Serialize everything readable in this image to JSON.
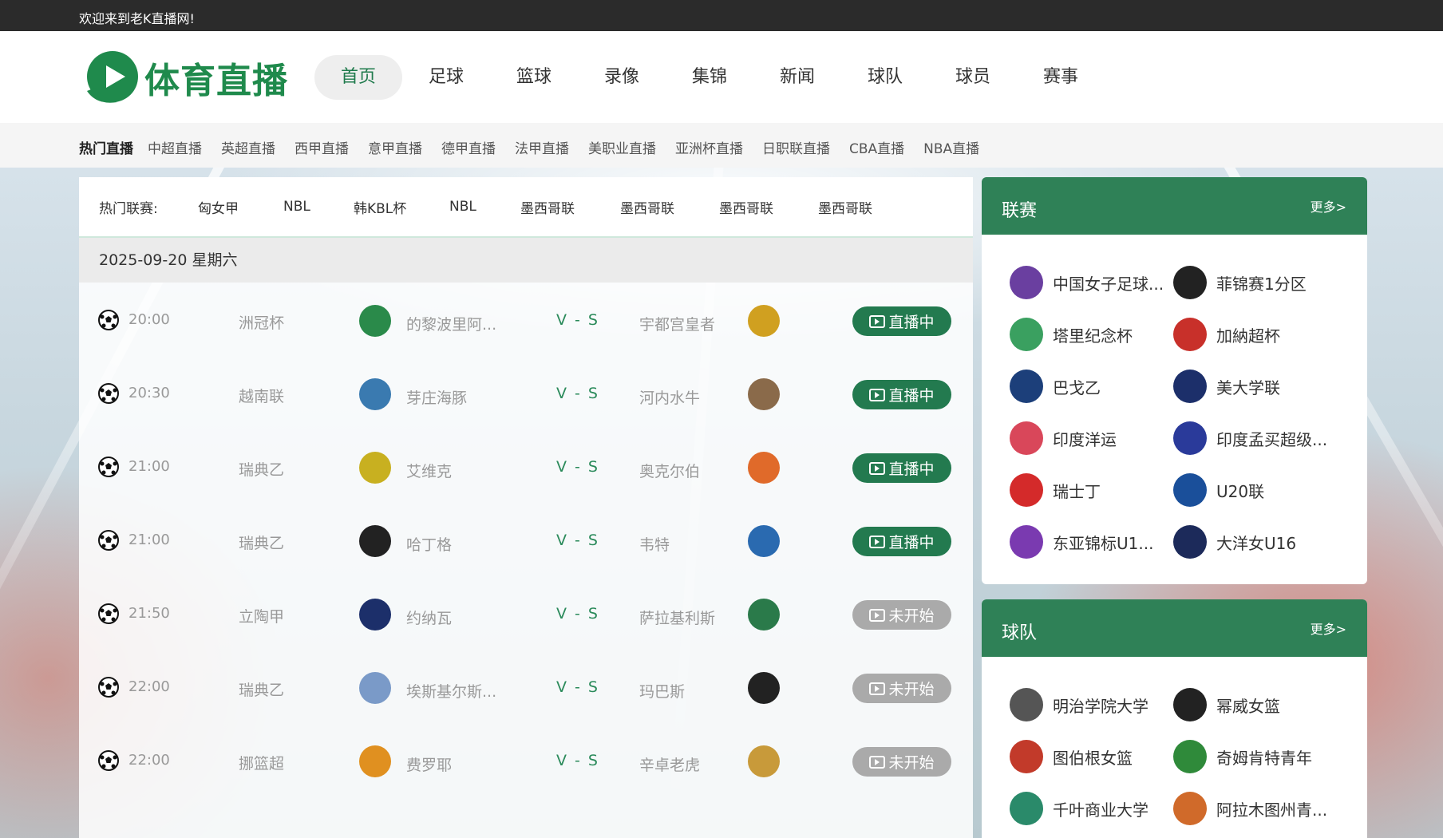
{
  "topbar": {
    "welcome": "欢迎来到老K直播网!"
  },
  "logo": {
    "text": "体育直播"
  },
  "nav": {
    "items": [
      {
        "label": "首页",
        "active": true
      },
      {
        "label": "足球"
      },
      {
        "label": "篮球"
      },
      {
        "label": "录像"
      },
      {
        "label": "集锦"
      },
      {
        "label": "新闻"
      },
      {
        "label": "球队"
      },
      {
        "label": "球员"
      },
      {
        "label": "赛事"
      }
    ]
  },
  "subnav": {
    "label": "热门直播",
    "links": [
      "中超直播",
      "英超直播",
      "西甲直播",
      "意甲直播",
      "德甲直播",
      "法甲直播",
      "美职业直播",
      "亚洲杯直播",
      "日职联直播",
      "CBA直播",
      "NBA直播"
    ]
  },
  "hot": {
    "label": "热门联赛:",
    "tags": [
      "匈女甲",
      "NBL",
      "韩KBL杯",
      "NBL",
      "墨西哥联",
      "墨西哥联",
      "墨西哥联",
      "墨西哥联"
    ]
  },
  "date": "2025-09-20 星期六",
  "matches": [
    {
      "time": "20:00",
      "league": "洲冠杯",
      "home": "的黎波里阿...",
      "vs": "V - S",
      "away": "宇都宫皇者",
      "status": "直播中",
      "live": true
    },
    {
      "time": "20:30",
      "league": "越南联",
      "home": "芽庄海豚",
      "vs": "V - S",
      "away": "河内水牛",
      "status": "直播中",
      "live": true
    },
    {
      "time": "21:00",
      "league": "瑞典乙",
      "home": "艾维克",
      "vs": "V - S",
      "away": "奥克尔伯",
      "status": "直播中",
      "live": true
    },
    {
      "time": "21:00",
      "league": "瑞典乙",
      "home": "哈丁格",
      "vs": "V - S",
      "away": "韦特",
      "status": "直播中",
      "live": true
    },
    {
      "time": "21:50",
      "league": "立陶甲",
      "home": "约纳瓦",
      "vs": "V - S",
      "away": "萨拉基利斯",
      "status": "未开始",
      "live": false
    },
    {
      "time": "22:00",
      "league": "瑞典乙",
      "home": "埃斯基尔斯...",
      "vs": "V - S",
      "away": "玛巴斯",
      "status": "未开始",
      "live": false
    },
    {
      "time": "22:00",
      "league": "挪篮超",
      "home": "费罗耶",
      "vs": "V - S",
      "away": "辛卓老虎",
      "status": "未开始",
      "live": false
    }
  ],
  "leagues": {
    "title": "联赛",
    "more": "更多>",
    "items": [
      {
        "name": "中国女子足球...",
        "icon": "cfa-icon",
        "color": "#6a3fa0"
      },
      {
        "name": "菲锦赛1分区",
        "icon": "angliga-icon",
        "color": "#222222"
      },
      {
        "name": "塔里纪念杯",
        "icon": "trophy-icon",
        "color": "#3aa060"
      },
      {
        "name": "加納超杯",
        "icon": "cup-icon",
        "color": "#c8302a"
      },
      {
        "name": "巴戈乙",
        "icon": "goiano-icon",
        "color": "#1c3f7a"
      },
      {
        "name": "美大学联",
        "icon": "runner-icon",
        "color": "#1c2f6a"
      },
      {
        "name": "印度洋运",
        "icon": "games-icon",
        "color": "#d9475a"
      },
      {
        "name": "印度孟买超级...",
        "icon": "shield-icon",
        "color": "#2a3a9a"
      },
      {
        "name": "瑞士丁",
        "icon": "swiss-icon",
        "color": "#d42a2a"
      },
      {
        "name": "U20联",
        "icon": "u20-icon",
        "color": "#1a4f9a"
      },
      {
        "name": "东亚锦标U1...",
        "icon": "eaff-icon",
        "color": "#7a3ab0"
      },
      {
        "name": "大洋女U16",
        "icon": "ofc-icon",
        "color": "#1c2a5a"
      }
    ]
  },
  "teams": {
    "title": "球队",
    "more": "更多>",
    "items": [
      {
        "name": "明治学院大学",
        "icon": "meiji-icon",
        "color": "#555555"
      },
      {
        "name": "幂威女篮",
        "icon": "threat-icon",
        "color": "#222222"
      },
      {
        "name": "图伯根女篮",
        "icon": "ball-icon",
        "color": "#c23a2a"
      },
      {
        "name": "奇姆肯特青年",
        "icon": "crest-icon",
        "color": "#2f8a3a"
      },
      {
        "name": "千叶商业大学",
        "icon": "cuc-icon",
        "color": "#2a8a6a"
      },
      {
        "name": "阿拉木图州青...",
        "icon": "basketball-icon",
        "color": "#d06a2a"
      }
    ]
  }
}
